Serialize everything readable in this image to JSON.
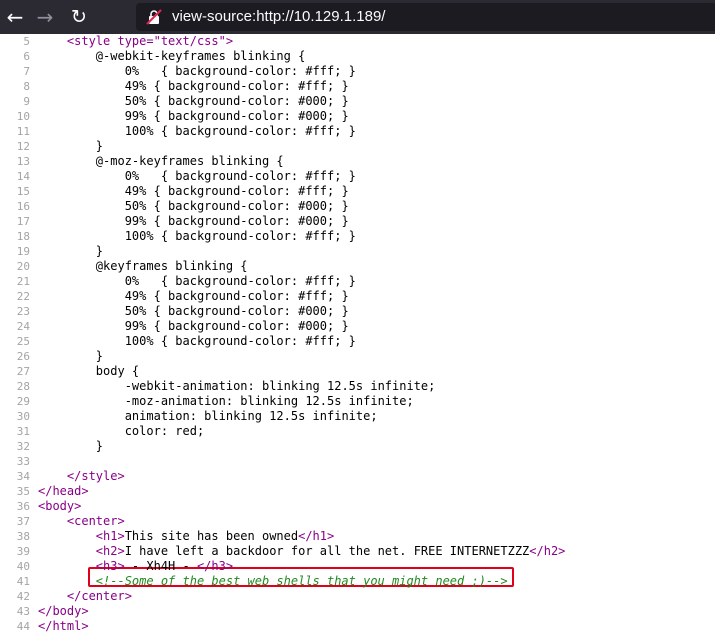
{
  "browser": {
    "url": "view-source:http://10.129.1.189/",
    "back_icon": "arrow-left-icon",
    "forward_icon": "arrow-right-icon",
    "reload_icon": "reload-icon",
    "security_icon": "insecure-lock-icon"
  },
  "source_lines": [
    {
      "n": "5",
      "indent": "    ",
      "text": "<style type=\"text/css\">"
    },
    {
      "n": "6",
      "indent": "        ",
      "text": "@-webkit-keyframes blinking {"
    },
    {
      "n": "7",
      "indent": "            ",
      "text": "0%   { background-color: #fff; }"
    },
    {
      "n": "8",
      "indent": "            ",
      "text": "49% { background-color: #fff; }"
    },
    {
      "n": "9",
      "indent": "            ",
      "text": "50% { background-color: #000; }"
    },
    {
      "n": "10",
      "indent": "            ",
      "text": "99% { background-color: #000; }"
    },
    {
      "n": "11",
      "indent": "            ",
      "text": "100% { background-color: #fff; }"
    },
    {
      "n": "12",
      "indent": "        ",
      "text": "}"
    },
    {
      "n": "13",
      "indent": "        ",
      "text": "@-moz-keyframes blinking {"
    },
    {
      "n": "14",
      "indent": "            ",
      "text": "0%   { background-color: #fff; }"
    },
    {
      "n": "15",
      "indent": "            ",
      "text": "49% { background-color: #fff; }"
    },
    {
      "n": "16",
      "indent": "            ",
      "text": "50% { background-color: #000; }"
    },
    {
      "n": "17",
      "indent": "            ",
      "text": "99% { background-color: #000; }"
    },
    {
      "n": "18",
      "indent": "            ",
      "text": "100% { background-color: #fff; }"
    },
    {
      "n": "19",
      "indent": "        ",
      "text": "}"
    },
    {
      "n": "20",
      "indent": "        ",
      "text": "@keyframes blinking {"
    },
    {
      "n": "21",
      "indent": "            ",
      "text": "0%   { background-color: #fff; }"
    },
    {
      "n": "22",
      "indent": "            ",
      "text": "49% { background-color: #fff; }"
    },
    {
      "n": "23",
      "indent": "            ",
      "text": "50% { background-color: #000; }"
    },
    {
      "n": "24",
      "indent": "            ",
      "text": "99% { background-color: #000; }"
    },
    {
      "n": "25",
      "indent": "            ",
      "text": "100% { background-color: #fff; }"
    },
    {
      "n": "26",
      "indent": "        ",
      "text": "}"
    },
    {
      "n": "27",
      "indent": "        ",
      "text": "body {"
    },
    {
      "n": "28",
      "indent": "            ",
      "text": "-webkit-animation: blinking 12.5s infinite;"
    },
    {
      "n": "29",
      "indent": "            ",
      "text": "-moz-animation: blinking 12.5s infinite;"
    },
    {
      "n": "30",
      "indent": "            ",
      "text": "animation: blinking 12.5s infinite;"
    },
    {
      "n": "31",
      "indent": "            ",
      "text": "color: red;"
    },
    {
      "n": "32",
      "indent": "        ",
      "text": "}"
    },
    {
      "n": "33",
      "indent": "",
      "text": ""
    },
    {
      "n": "34",
      "indent": "    ",
      "text": "</style>"
    },
    {
      "n": "35",
      "indent": "",
      "text": "</head>"
    },
    {
      "n": "36",
      "indent": "",
      "text": "<body>"
    },
    {
      "n": "37",
      "indent": "    ",
      "text": "<center>"
    },
    {
      "n": "38",
      "indent": "        ",
      "text": "<h1>This site has been owned</h1>"
    },
    {
      "n": "39",
      "indent": "        ",
      "text": "<h2>I have left a backdoor for all the net. FREE INTERNETZZZ</h2>"
    },
    {
      "n": "40",
      "indent": "        ",
      "text": "<h3> - Xh4H - </h3>"
    },
    {
      "n": "41",
      "indent": "        ",
      "text": "<!--Some of the best web shells that you might need ;)-->"
    },
    {
      "n": "42",
      "indent": "    ",
      "text": "</center>"
    },
    {
      "n": "43",
      "indent": "",
      "text": "</body>"
    },
    {
      "n": "44",
      "indent": "",
      "text": "</html>"
    }
  ],
  "colors": {
    "tag": "#880088",
    "comment": "#1f8a1f",
    "highlight_border": "#e0001a"
  }
}
